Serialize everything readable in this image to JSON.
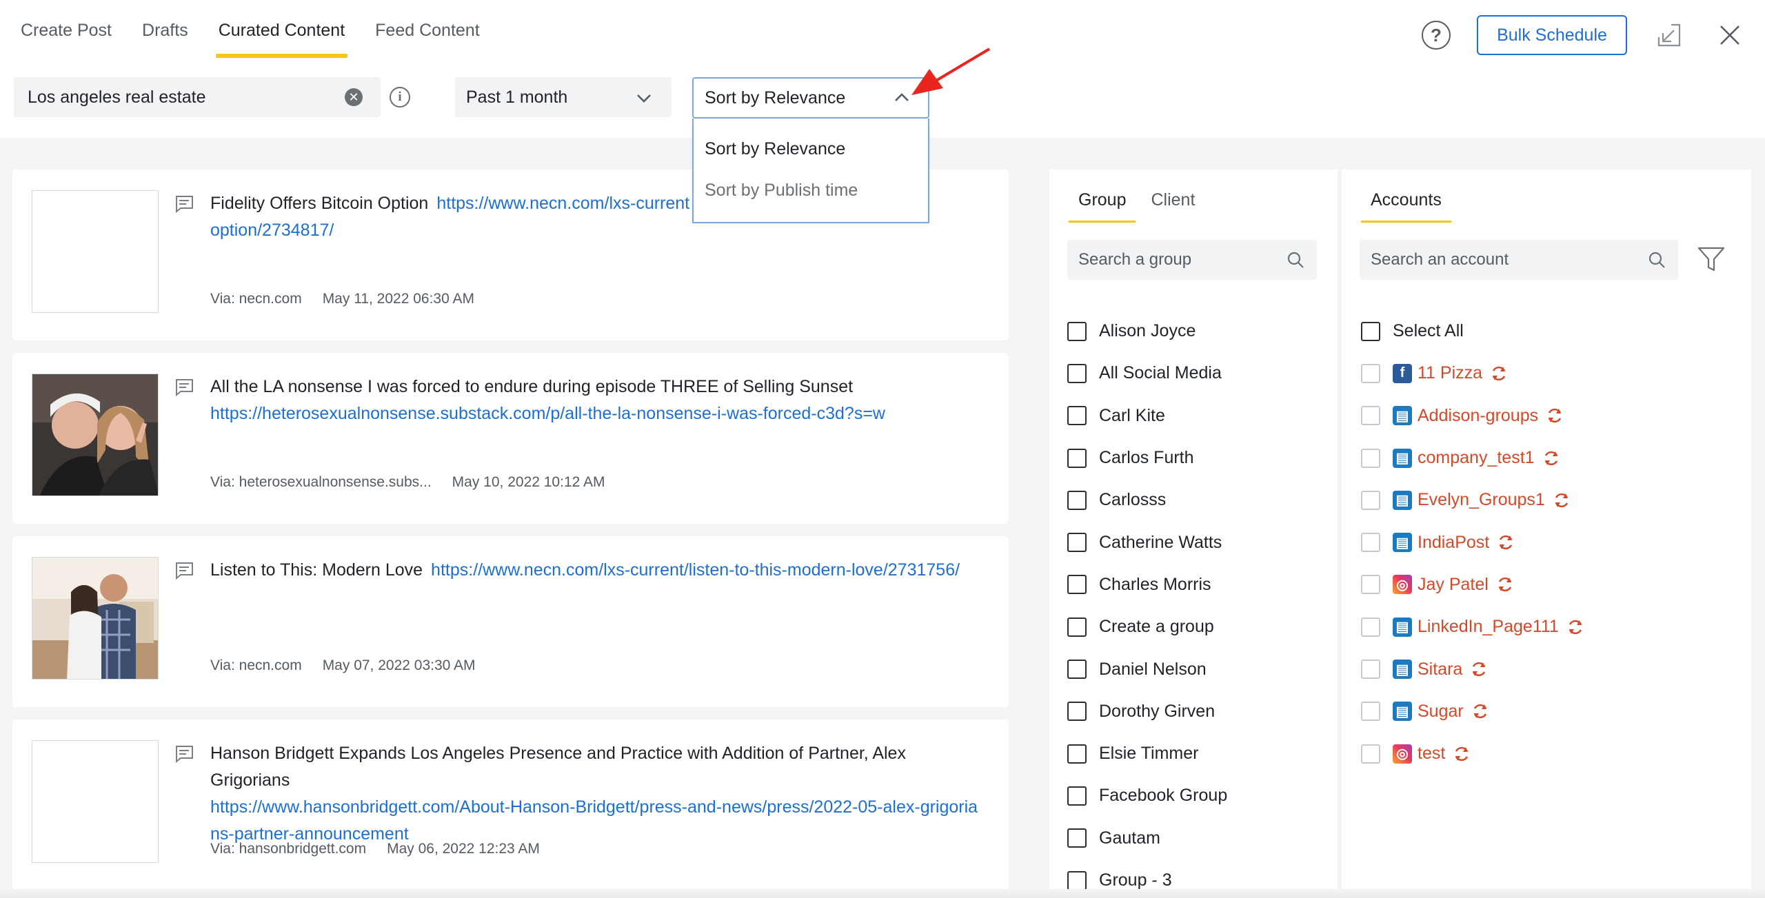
{
  "tabs": [
    {
      "label": "Create Post"
    },
    {
      "label": "Drafts"
    },
    {
      "label": "Curated Content",
      "active": true
    },
    {
      "label": "Feed Content"
    }
  ],
  "header": {
    "help_label": "?",
    "bulk_schedule_label": "Bulk Schedule"
  },
  "filters": {
    "search_value": "Los angeles real estate",
    "time_range": "Past 1 month",
    "sort_selected": "Sort by Relevance",
    "sort_options": [
      "Sort by Relevance",
      "Sort by Publish time"
    ]
  },
  "feed": [
    {
      "title": "Fidelity Offers Bitcoin Option",
      "link": "https://www.necn.com/lxs-current/fidelity-offers-bitcoin-option/2734817/",
      "link_shown_line1": "https://www.necn.com/lxs-current",
      "link_shown_line2": "option/2734817/",
      "via": "Via: necn.com",
      "date": "May 11, 2022 06:30 AM",
      "thumbnail": "empty"
    },
    {
      "title": "All the LA nonsense I was forced to endure during episode THREE of Selling Sunset",
      "link": "https://heterosexualnonsense.substack.com/p/all-the-la-nonsense-i-was-forced-c3d?s=w",
      "via": "Via: heterosexualnonsense.subs...",
      "date": "May 10, 2022 10:12 AM",
      "thumbnail": "selfie-photo"
    },
    {
      "title": "Listen to This: Modern Love",
      "link": "https://www.necn.com/lxs-current/listen-to-this-modern-love/2731756/",
      "via": "Via: necn.com",
      "date": "May 07, 2022 03:30 AM",
      "thumbnail": "couple-photo"
    },
    {
      "title": "Hanson Bridgett Expands Los Angeles Presence and Practice with Addition of Partner, Alex Grigorians",
      "link": "https://www.hansonbridgett.com/About-Hanson-Bridgett/press-and-news/press/2022-05-alex-grigorians-partner-announcement",
      "via": "Via: hansonbridgett.com",
      "date": "May 06, 2022 12:23 AM",
      "thumbnail": "empty"
    }
  ],
  "group_panel": {
    "tabs": [
      {
        "label": "Group"
      },
      {
        "label": "Client"
      }
    ],
    "search_placeholder": "Search a group",
    "groups": [
      "Alison Joyce",
      "All Social Media",
      "Carl Kite",
      "Carlos Furth",
      "Carlosss",
      "Catherine Watts",
      "Charles Morris",
      "Create a group",
      "Daniel Nelson",
      "Dorothy Girven",
      "Elsie Timmer",
      "Facebook Group",
      "Gautam",
      "Group - 3"
    ]
  },
  "accounts_panel": {
    "tab_label": "Accounts",
    "search_placeholder": "Search an account",
    "select_all_label": "Select All",
    "accounts": [
      {
        "name": "11 Pizza",
        "network": "facebook"
      },
      {
        "name": "Addison-groups",
        "network": "linkedin"
      },
      {
        "name": "company_test1",
        "network": "linkedin"
      },
      {
        "name": "Evelyn_Groups1",
        "network": "linkedin"
      },
      {
        "name": "IndiaPost",
        "network": "linkedin"
      },
      {
        "name": "Jay Patel",
        "network": "instagram"
      },
      {
        "name": "LinkedIn_Page111",
        "network": "linkedin"
      },
      {
        "name": "Sitara",
        "network": "linkedin"
      },
      {
        "name": "Sugar",
        "network": "linkedin"
      },
      {
        "name": "test",
        "network": "instagram"
      }
    ]
  },
  "colors": {
    "accent_yellow": "#f5c518",
    "link_blue": "#1d6fd1",
    "account_red": "#d24a2a",
    "annotation_arrow": "#e8251f"
  }
}
